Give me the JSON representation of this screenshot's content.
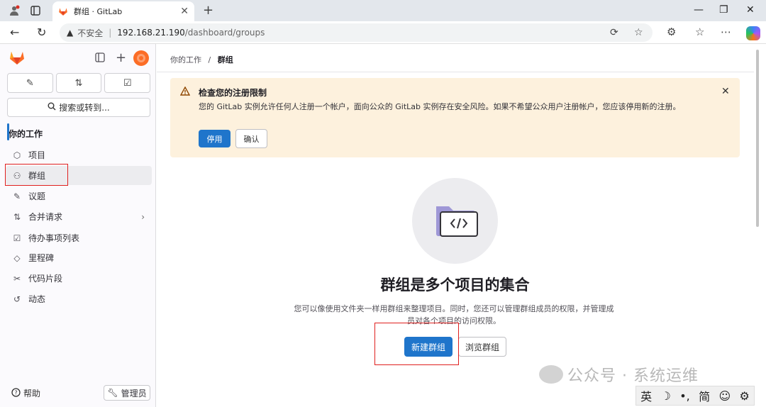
{
  "browser": {
    "tab_title": "群组 · GitLab",
    "tab_close": "✕",
    "new_tab": "+",
    "insecure_label": "不安全",
    "url_host": "192.168.21.190",
    "url_path": "/dashboard/groups"
  },
  "sidebar": {
    "search_label": "搜索或转到...",
    "heading": "你的工作",
    "items": [
      {
        "label": "项目",
        "icon": "project-icon"
      },
      {
        "label": "群组",
        "icon": "group-icon"
      },
      {
        "label": "议题",
        "icon": "issues-icon"
      },
      {
        "label": "合并请求",
        "icon": "merge-request-icon"
      },
      {
        "label": "待办事项列表",
        "icon": "todo-icon"
      },
      {
        "label": "里程碑",
        "icon": "milestone-icon"
      },
      {
        "label": "代码片段",
        "icon": "snippet-icon"
      },
      {
        "label": "动态",
        "icon": "activity-icon"
      }
    ],
    "help_label": "帮助",
    "admin_label": "管理员"
  },
  "breadcrumb": {
    "parent": "你的工作",
    "separator": "/",
    "current": "群组"
  },
  "alert": {
    "title": "检查您的注册限制",
    "body": "您的 GitLab 实例允许任何人注册一个帐户，面向公众的 GitLab 实例存在安全风险。如果不希望公众用户注册帐户，您应该停用新的注册。",
    "disable_label": "停用",
    "confirm_label": "确认"
  },
  "empty_state": {
    "title": "群组是多个项目的集合",
    "description": "您可以像使用文件夹一样用群组来整理项目。同时，您还可以管理群组成员的权限，并管理成员对各个项目的访问权限。",
    "new_group_label": "新建群组",
    "browse_label": "浏览群组"
  },
  "watermark": "公众号 · 系统运维",
  "ime": {
    "lang": "英",
    "mode": "简"
  },
  "colors": {
    "primary": "#1f75cb",
    "alert_bg": "#fdf1dd",
    "highlight": "#e0201f",
    "gitlab_orange": "#fc6d26"
  }
}
